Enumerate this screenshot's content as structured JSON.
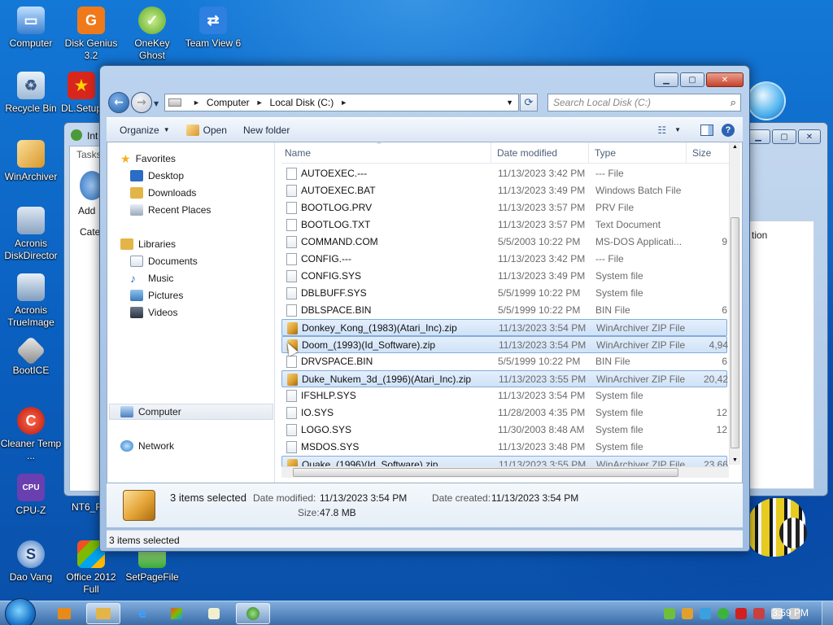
{
  "desktop": {
    "icons": [
      {
        "label": "Computer"
      },
      {
        "label": "Disk Genius 3.2"
      },
      {
        "label": "OneKey Ghost"
      },
      {
        "label": "Team View 6"
      },
      {
        "label": "Recycle Bin"
      },
      {
        "label": "DL.Setup"
      },
      {
        "label": "WinArchiver"
      },
      {
        "label": "Acronis DiskDirector"
      },
      {
        "label": "Acronis TrueImage"
      },
      {
        "label": "BootICE"
      },
      {
        "label": "Cleaner Temp ..."
      },
      {
        "label": "CPU-Z"
      },
      {
        "label": "Dao Vang"
      },
      {
        "label": "Office 2012 Full"
      },
      {
        "label": "SetPageFile"
      },
      {
        "label": "NT6_F"
      }
    ]
  },
  "bg_window": {
    "title": "Int",
    "tasks_label": "Tasks",
    "add_label": "Add",
    "category_label": "Categ",
    "right_header": "tion"
  },
  "explorer": {
    "address": {
      "crumbs": [
        "Computer",
        "Local Disk (C:)"
      ]
    },
    "search_placeholder": "Search Local Disk (C:)",
    "toolbar": {
      "organize": "Organize",
      "open": "Open",
      "new_folder": "New folder"
    },
    "nav": {
      "favorites": "Favorites",
      "desktop": "Desktop",
      "downloads": "Downloads",
      "recent_places": "Recent Places",
      "libraries": "Libraries",
      "documents": "Documents",
      "music": "Music",
      "pictures": "Pictures",
      "videos": "Videos",
      "computer": "Computer",
      "network": "Network"
    },
    "columns": {
      "name": "Name",
      "date": "Date modified",
      "type": "Type",
      "size": "Size"
    },
    "files": [
      {
        "name": "AUTOEXEC.---",
        "date": "11/13/2023 3:42 PM",
        "type": "--- File",
        "size": "",
        "icon": "file",
        "selected": false
      },
      {
        "name": "AUTOEXEC.BAT",
        "date": "11/13/2023 3:49 PM",
        "type": "Windows Batch File",
        "size": "",
        "icon": "sys",
        "selected": false
      },
      {
        "name": "BOOTLOG.PRV",
        "date": "11/13/2023 3:57 PM",
        "type": "PRV File",
        "size": "",
        "icon": "file",
        "selected": false
      },
      {
        "name": "BOOTLOG.TXT",
        "date": "11/13/2023 3:57 PM",
        "type": "Text Document",
        "size": "",
        "icon": "file",
        "selected": false
      },
      {
        "name": "COMMAND.COM",
        "date": "5/5/2003 10:22 PM",
        "type": "MS-DOS Applicati...",
        "size": "9",
        "icon": "sys",
        "selected": false
      },
      {
        "name": "CONFIG.---",
        "date": "11/13/2023 3:42 PM",
        "type": "--- File",
        "size": "",
        "icon": "file",
        "selected": false
      },
      {
        "name": "CONFIG.SYS",
        "date": "11/13/2023 3:49 PM",
        "type": "System file",
        "size": "",
        "icon": "sys",
        "selected": false
      },
      {
        "name": "DBLBUFF.SYS",
        "date": "5/5/1999 10:22 PM",
        "type": "System file",
        "size": "",
        "icon": "sys",
        "selected": false
      },
      {
        "name": "DBLSPACE.BIN",
        "date": "5/5/1999 10:22 PM",
        "type": "BIN File",
        "size": "6",
        "icon": "file",
        "selected": false
      },
      {
        "name": "Donkey_Kong_(1983)(Atari_Inc).zip",
        "date": "11/13/2023 3:54 PM",
        "type": "WinArchiver ZIP File",
        "size": "",
        "icon": "zip",
        "selected": true
      },
      {
        "name": "Doom_(1993)(Id_Software).zip",
        "date": "11/13/2023 3:54 PM",
        "type": "WinArchiver ZIP File",
        "size": "4,94",
        "icon": "zip",
        "selected": true
      },
      {
        "name": "DRVSPACE.BIN",
        "date": "5/5/1999 10:22 PM",
        "type": "BIN File",
        "size": "6",
        "icon": "file",
        "selected": false
      },
      {
        "name": "Duke_Nukem_3d_(1996)(Atari_Inc).zip",
        "date": "11/13/2023 3:55 PM",
        "type": "WinArchiver ZIP File",
        "size": "20,42",
        "icon": "zip",
        "selected": true
      },
      {
        "name": "IFSHLP.SYS",
        "date": "11/13/2023 3:54 PM",
        "type": "System file",
        "size": "",
        "icon": "sys",
        "selected": false
      },
      {
        "name": "IO.SYS",
        "date": "11/28/2003 4:35 PM",
        "type": "System file",
        "size": "12",
        "icon": "sys",
        "selected": false
      },
      {
        "name": "LOGO.SYS",
        "date": "11/30/2003 8:48 AM",
        "type": "System file",
        "size": "12",
        "icon": "sys",
        "selected": false
      },
      {
        "name": "MSDOS.SYS",
        "date": "11/13/2023 3:48 PM",
        "type": "System file",
        "size": "",
        "icon": "sys",
        "selected": false
      },
      {
        "name": "Quake_(1996)(Id_Software).zip",
        "date": "11/13/2023 3:55 PM",
        "type": "WinArchiver ZIP File",
        "size": "23,66",
        "icon": "zip",
        "selected": true
      }
    ],
    "details": {
      "items_selected": "3 items selected",
      "date_modified_label": "Date modified:",
      "date_modified": "11/13/2023 3:54 PM",
      "date_created_label": "Date created:",
      "date_created": "11/13/2023 3:54 PM",
      "size_label": "Size:",
      "size": "47.8 MB"
    },
    "status": "3 items selected"
  },
  "taskbar": {
    "clock": "3:59 PM"
  }
}
